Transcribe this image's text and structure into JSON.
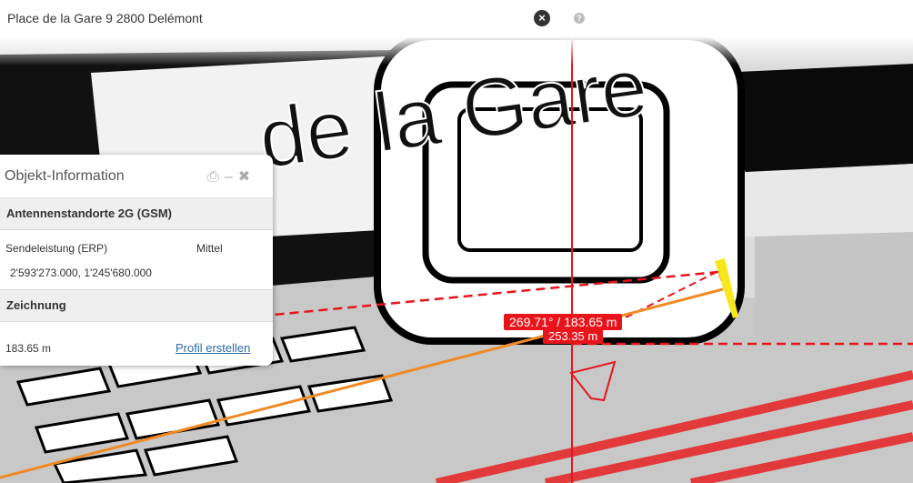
{
  "search": {
    "value": "Place de la Gare 9 2800 Delémont",
    "clear_icon": "times-circle-icon",
    "help_icon": "question-circle-icon"
  },
  "map": {
    "street_label": "de la Gare",
    "colors": {
      "measure": "#e8141b",
      "profile": "#f08a24",
      "antenna": "#f5e71a"
    }
  },
  "popup": {
    "title": "Objekt-Information",
    "icons": [
      "print-icon",
      "minimize-icon",
      "close-icon"
    ],
    "section1": {
      "header": "Antennenstandorte 2G (GSM)",
      "rows": [
        {
          "label": "Sendeleistung (ERP)",
          "value": "Mittel"
        },
        {
          "label": "",
          "value": "2'593'273.000, 1'245'680.000"
        }
      ]
    },
    "section2": {
      "header": "Zeichnung",
      "distance": "183.65 m",
      "link": "Profil erstellen"
    }
  },
  "measure": {
    "azimuth_distance": "269.71° / 183.65 m",
    "secondary": "253.35 m"
  }
}
